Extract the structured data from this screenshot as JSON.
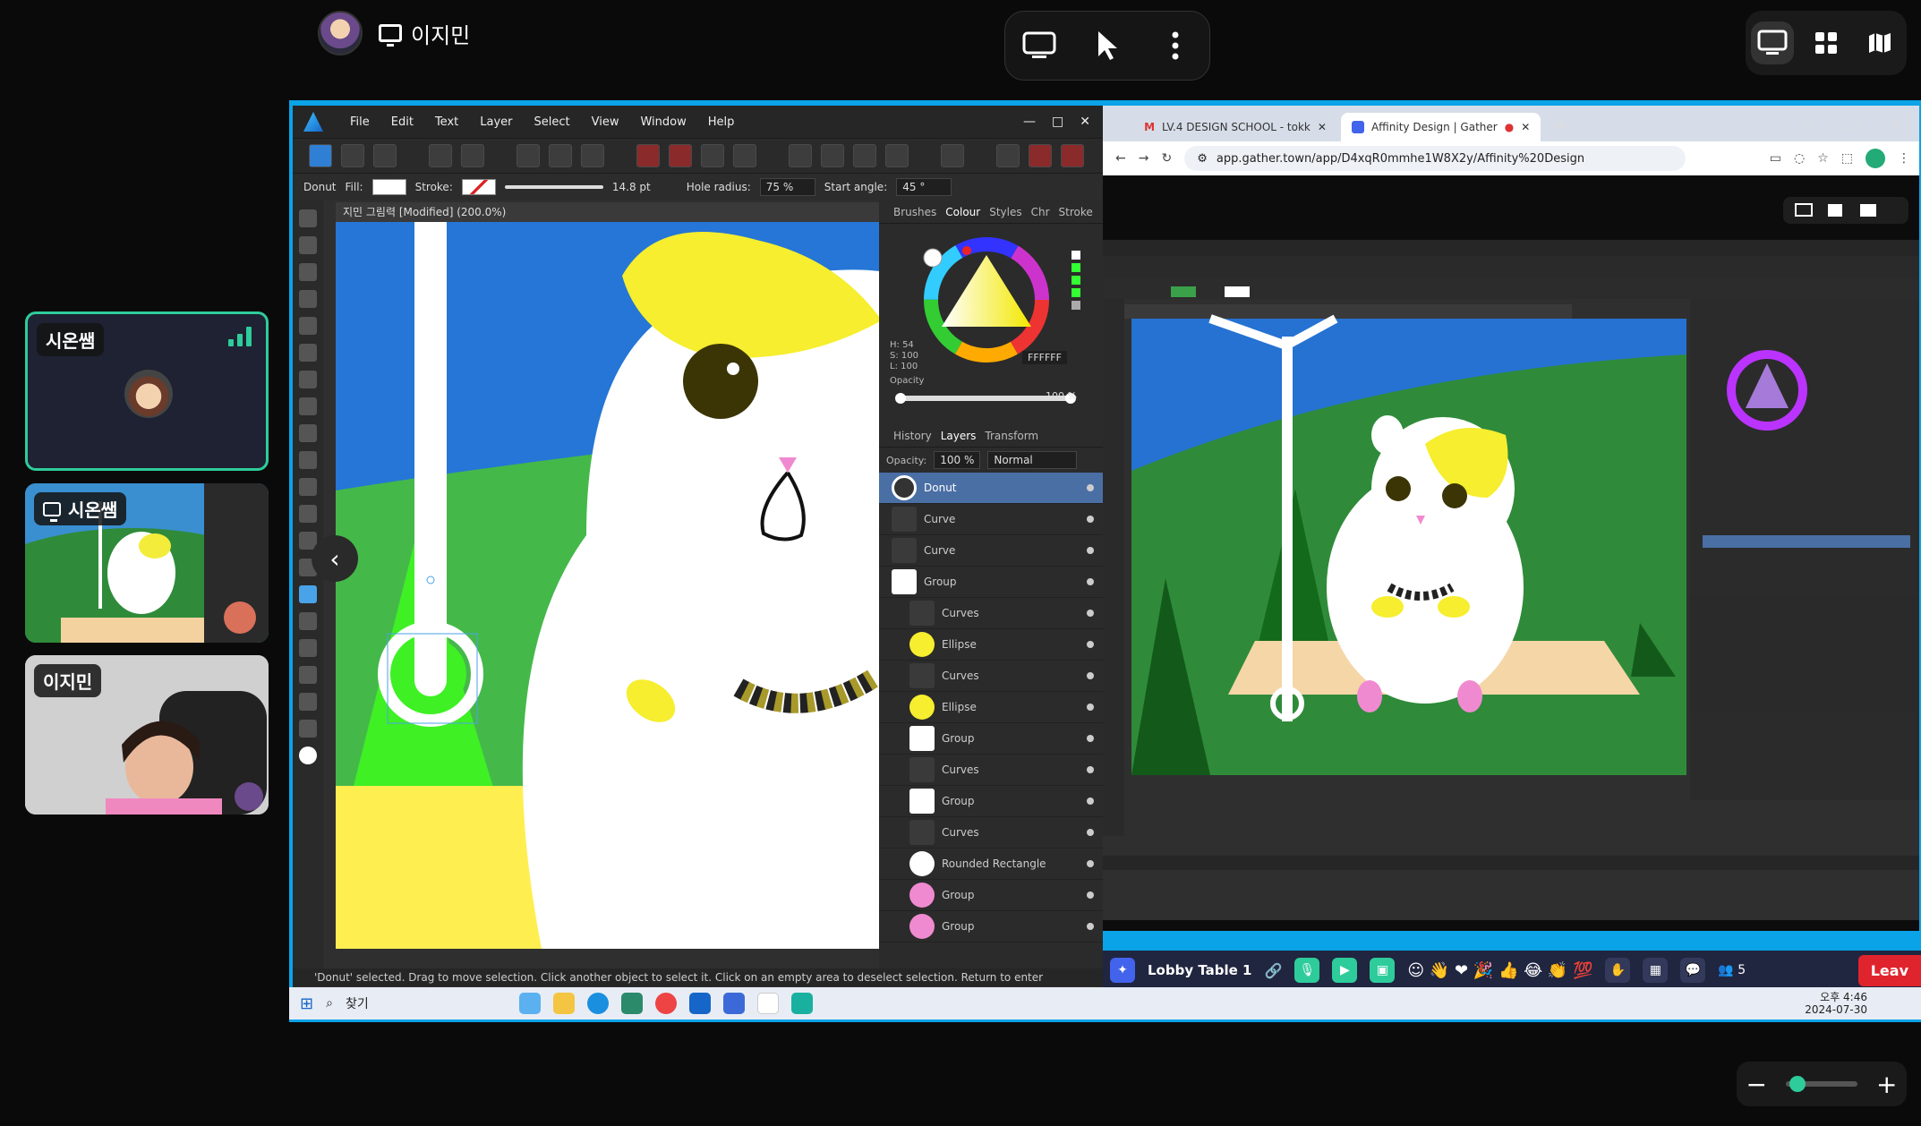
{
  "topbar": {
    "user_name": "이지민"
  },
  "tiles": [
    {
      "label": "시온쌤"
    },
    {
      "label": "시온쌤"
    },
    {
      "label": "이지민"
    }
  ],
  "affinity": {
    "menu": [
      "File",
      "Edit",
      "Text",
      "Layer",
      "Select",
      "View",
      "Window",
      "Help"
    ],
    "context": {
      "tool": "Donut",
      "fill_label": "Fill:",
      "stroke_label": "Stroke:",
      "stroke_width": "14.8 pt",
      "hole_radius_label": "Hole radius:",
      "hole_radius": "75 %",
      "start_angle_label": "Start angle:",
      "start_angle": "45 °"
    },
    "doc_title": "지민 그림력 [Modified] (200.0%)",
    "color_tabs": [
      "Brushes",
      "Colour",
      "Styles",
      "Chr",
      "Stroke"
    ],
    "color_values": {
      "h": "H: 54",
      "s": "S: 100",
      "l": "L: 100",
      "hex": "FFFFFF",
      "opacity_label": "Opacity",
      "opacity": "100 %"
    },
    "layer_tabs": [
      "History",
      "Layers",
      "Transform"
    ],
    "layer_opts": {
      "opacity_label": "Opacity:",
      "opacity": "100 %",
      "blend": "Normal"
    },
    "layers": [
      "Donut",
      "Curve",
      "Curve",
      "Group",
      "Curves",
      "Ellipse",
      "Curves",
      "Ellipse",
      "Group",
      "Curves",
      "Group",
      "Curves",
      "Rounded Rectangle",
      "Group",
      "Group"
    ],
    "status_text": "'Donut' selected. Drag to move selection. Click another object to select it. Click on an empty area to deselect selection. Return to enter move/duplicate values."
  },
  "chrome": {
    "tabs": [
      {
        "title": "LV.4 DESIGN SCHOOL - tokk"
      },
      {
        "title": "Affinity Design | Gather"
      }
    ],
    "url": "app.gather.town/app/D4xqR0mmhe1W8X2y/Affinity%20Design"
  },
  "gather": {
    "room": "Lobby Table 1",
    "participants": "5",
    "leave": "Leav"
  },
  "taskbar": {
    "search": "찾기",
    "time": "오후 4:46",
    "date": "2024-07-30"
  },
  "colors": {
    "accent": "#0aa3e8",
    "gather_green": "#2ecc9b",
    "leave_red": "#e0242d"
  }
}
